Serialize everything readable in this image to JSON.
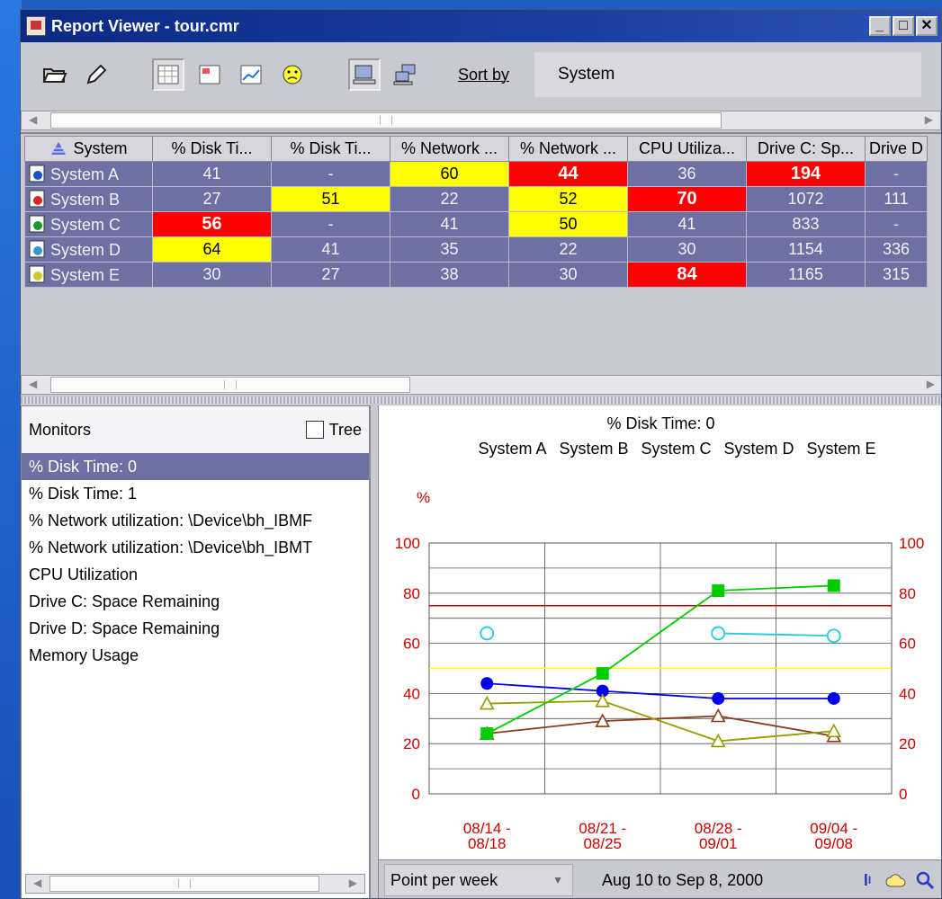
{
  "window": {
    "title": "Report Viewer - tour.cmr",
    "minimize": "_",
    "maximize": "□",
    "close": "✕"
  },
  "toolbar": {
    "sort_label": "Sort by",
    "sort_value": "System"
  },
  "table": {
    "headers": [
      "System",
      "% Disk Ti...",
      "% Disk Ti...",
      "% Network ...",
      "% Network ...",
      "CPU Utiliza...",
      "Drive C: Sp...",
      "Drive D"
    ],
    "rows": [
      {
        "name": "System A",
        "cells": [
          "41",
          "-",
          "60",
          "44",
          "36",
          "194",
          "-"
        ],
        "status": [
          "",
          "",
          "y",
          "r",
          "",
          "r",
          ""
        ]
      },
      {
        "name": "System B",
        "cells": [
          "27",
          "51",
          "22",
          "52",
          "70",
          "1072",
          "111"
        ],
        "status": [
          "",
          "y",
          "",
          "y",
          "r",
          "",
          ""
        ]
      },
      {
        "name": "System C",
        "cells": [
          "56",
          "-",
          "41",
          "50",
          "41",
          "833",
          "-"
        ],
        "status": [
          "r",
          "",
          "",
          "y",
          "",
          "",
          ""
        ]
      },
      {
        "name": "System D",
        "cells": [
          "64",
          "41",
          "35",
          "22",
          "30",
          "1154",
          "336"
        ],
        "status": [
          "y",
          "",
          "",
          "",
          "",
          "",
          ""
        ]
      },
      {
        "name": "System E",
        "cells": [
          "30",
          "27",
          "38",
          "30",
          "84",
          "1165",
          "315"
        ],
        "status": [
          "",
          "",
          "",
          "",
          "r",
          "",
          ""
        ]
      }
    ]
  },
  "monitors": {
    "title": "Monitors",
    "tree_label": "Tree",
    "items": [
      "% Disk Time: 0",
      "% Disk Time: 1",
      "% Network utilization: \\Device\\bh_IBMF",
      "% Network utilization: \\Device\\bh_IBMT",
      "CPU Utilization",
      "Drive C: Space Remaining",
      "Drive D: Space Remaining",
      "Memory Usage"
    ],
    "selected_index": 0
  },
  "chart_data": {
    "type": "line",
    "title": "% Disk Time: 0",
    "ylabel": "%",
    "categories": [
      "08/14 - 08/18",
      "08/21 - 08/25",
      "08/28 - 09/01",
      "09/04 - 09/08"
    ],
    "ylim": [
      0,
      100
    ],
    "yticks": [
      0,
      20,
      40,
      60,
      80,
      100
    ],
    "grid": true,
    "thresholds": [
      {
        "value": 75,
        "color": "#cc0000"
      },
      {
        "value": 50,
        "color": "#ffff00"
      }
    ],
    "series": [
      {
        "name": "System A",
        "color": "#0000ee",
        "marker": "filled-circle",
        "values": [
          44,
          41,
          38,
          38
        ]
      },
      {
        "name": "System B",
        "color": "#8a3a1a",
        "marker": "open-triangle",
        "values": [
          24,
          29,
          31,
          23
        ]
      },
      {
        "name": "System C",
        "color": "#00cc00",
        "marker": "filled-square",
        "values": [
          24,
          48,
          81,
          83
        ]
      },
      {
        "name": "System D",
        "color": "#22ccdd",
        "marker": "open-circle",
        "values": [
          64,
          null,
          64,
          63
        ]
      },
      {
        "name": "System E",
        "color": "#999900",
        "marker": "open-triangle",
        "values": [
          36,
          37,
          21,
          25
        ]
      }
    ]
  },
  "footer": {
    "period": "Point per week",
    "range": "Aug 10 to Sep 8, 2000"
  }
}
